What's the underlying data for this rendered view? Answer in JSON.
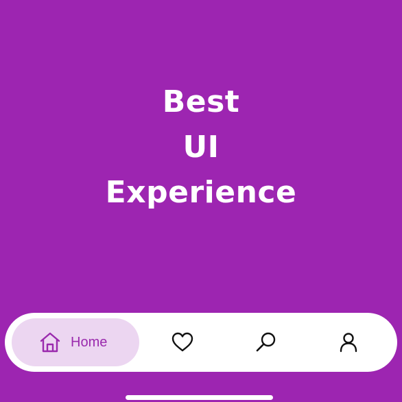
{
  "hero": {
    "line1": "Best",
    "line2": "UI",
    "line3": "Experience"
  },
  "nav": {
    "items": [
      {
        "label": "Home",
        "icon": "home-icon",
        "active": true
      },
      {
        "label": "",
        "icon": "heart-icon",
        "active": false
      },
      {
        "label": "",
        "icon": "search-icon",
        "active": false
      },
      {
        "label": "",
        "icon": "profile-icon",
        "active": false
      }
    ]
  },
  "colors": {
    "background": "#9d25b1",
    "nav_background": "#ffffff",
    "active_pill": "#ecd6f1",
    "active_text": "#9a2aad",
    "icon_inactive": "#111111"
  }
}
